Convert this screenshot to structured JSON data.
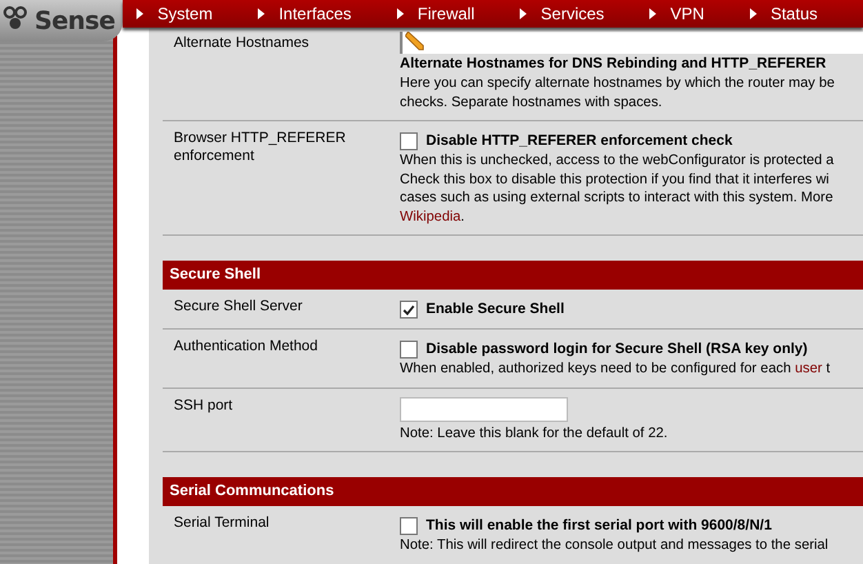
{
  "logo": {
    "text": "Sense"
  },
  "nav": [
    {
      "label": "System"
    },
    {
      "label": "Interfaces"
    },
    {
      "label": "Firewall"
    },
    {
      "label": "Services"
    },
    {
      "label": "VPN"
    },
    {
      "label": "Status"
    }
  ],
  "sections": [
    {
      "rows": [
        {
          "label": "Alternate Hostnames",
          "kind": "textarea",
          "heading": "Alternate Hostnames for DNS Rebinding and HTTP_REFERER",
          "lines": [
            "Here you can specify alternate hostnames by which the router may be",
            "checks. Separate hostnames with spaces."
          ]
        },
        {
          "label": "Browser HTTP_REFERER enforcement",
          "kind": "checkbox",
          "checked": false,
          "option": "Disable HTTP_REFERER enforcement check",
          "lines": [
            "When this is unchecked, access to the webConfigurator is protected a",
            "Check this box to disable this protection if you find that it interferes wi",
            "cases such as using external scripts to interact with this system. More",
            {
              "link": "Wikipedia",
              "tail": "."
            }
          ]
        }
      ]
    },
    {
      "title": "Secure Shell",
      "rows": [
        {
          "label": "Secure Shell Server",
          "kind": "checkbox",
          "checked": true,
          "option": "Enable Secure Shell",
          "lines": []
        },
        {
          "label": "Authentication Method",
          "kind": "checkbox",
          "checked": false,
          "option": "Disable password login for Secure Shell (RSA key only)",
          "lines": [
            {
              "text": "When enabled, authorized keys need to be configured for each ",
              "link": "user",
              "tail": " t"
            }
          ]
        },
        {
          "label": "SSH port",
          "kind": "input",
          "lines": [
            "Note: Leave this blank for the default of 22."
          ]
        }
      ]
    },
    {
      "title": "Serial Communcations",
      "rows": [
        {
          "label": "Serial Terminal",
          "kind": "checkbox",
          "checked": false,
          "option": "This will enable the first serial port with 9600/8/N/1",
          "lines": [
            "Note: This will redirect the console output and messages to the serial"
          ]
        }
      ]
    }
  ]
}
